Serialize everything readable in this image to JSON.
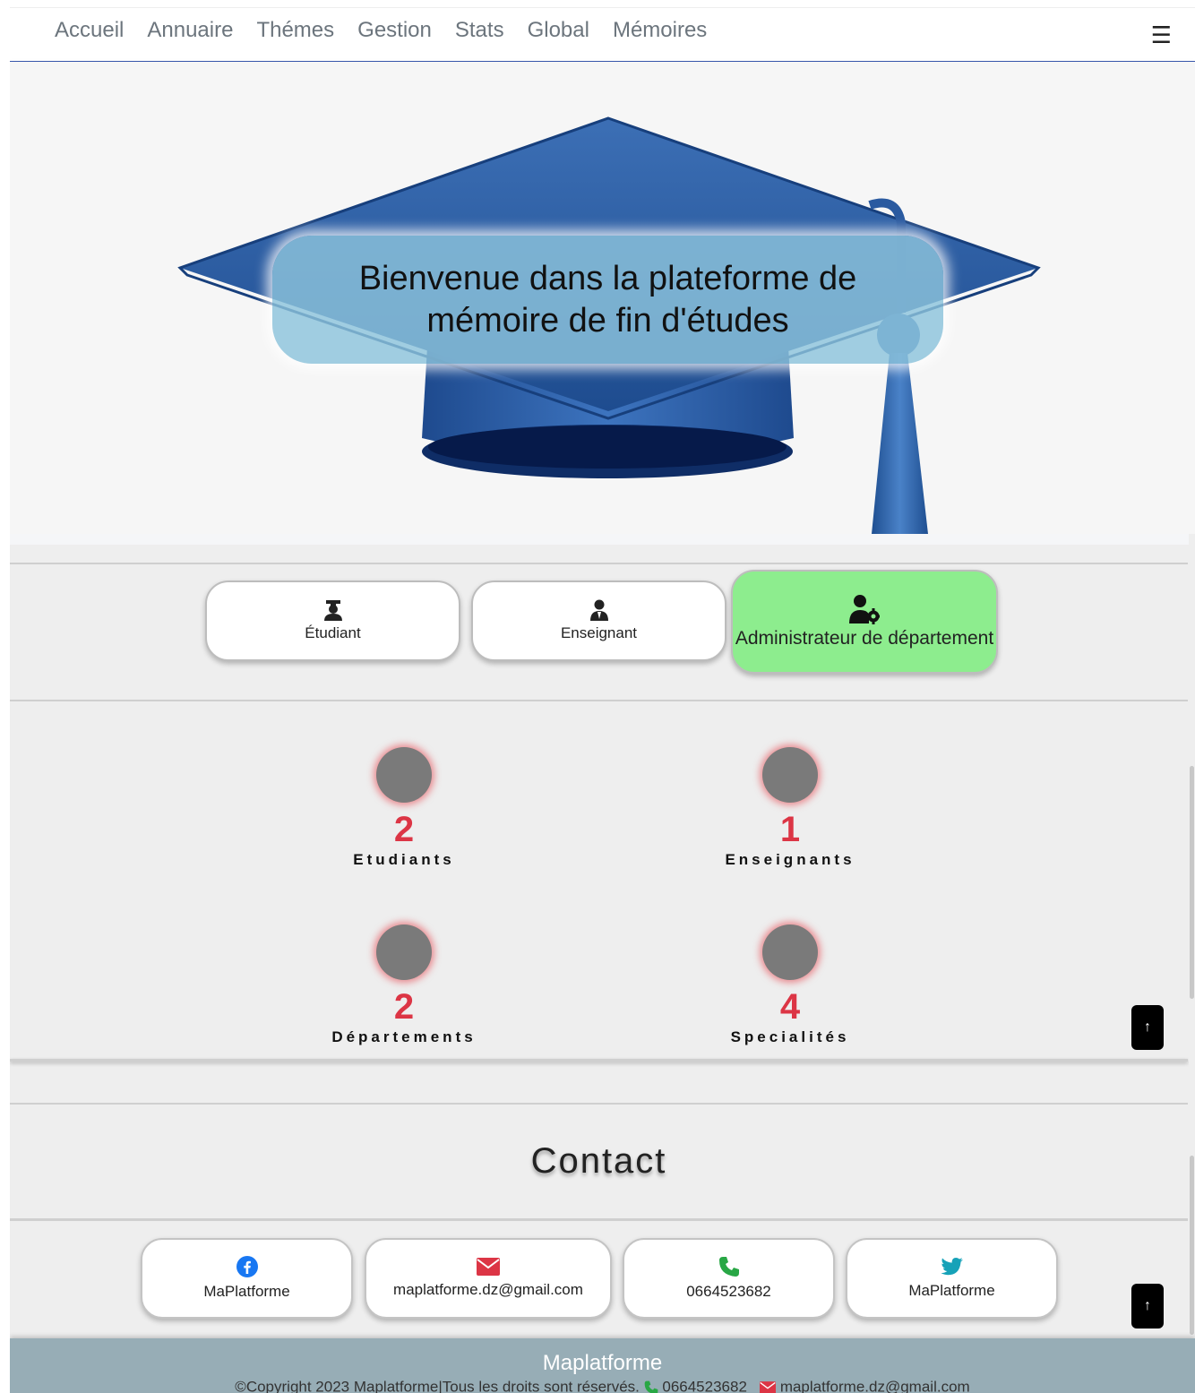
{
  "nav": {
    "links": [
      "Accueil",
      "Annuaire",
      "Thémes",
      "Gestion",
      "Stats",
      "Global",
      "Mémoires"
    ],
    "menu_icon": "hamburger-icon"
  },
  "hero": {
    "welcome": "Bienvenue dans la plateforme de mémoire de fin d'études",
    "cap_color": "#2a5aa0"
  },
  "roles": [
    {
      "label": "Étudiant",
      "icon": "graduate-icon",
      "active": false
    },
    {
      "label": "Enseignant",
      "icon": "teacher-icon",
      "active": false
    },
    {
      "label": "Administrateur de département",
      "icon": "user-gear-icon",
      "active": true
    }
  ],
  "stats": [
    {
      "value": "2",
      "label": "Etudiants"
    },
    {
      "value": "1",
      "label": "Enseignants"
    },
    {
      "value": "2",
      "label": "Départements"
    },
    {
      "value": "4",
      "label": "Specialités"
    }
  ],
  "contact": {
    "title": "Contact",
    "cards": [
      {
        "label": "MaPlatforme",
        "icon": "facebook-icon",
        "color": "#1877f2"
      },
      {
        "label": "maplatforme.dz@gmail.com",
        "icon": "envelope-icon",
        "color": "#dc3545"
      },
      {
        "label": "0664523682",
        "icon": "phone-icon",
        "color": "#28a745"
      },
      {
        "label": "MaPlatforme",
        "icon": "twitter-icon",
        "color": "#17a2b8"
      }
    ]
  },
  "footer": {
    "title": "Maplatforme",
    "copyright": "©Copyright 2023 Maplatforme|Tous les droits sont réservés.",
    "phone": "0664523682",
    "email": "maplatforme.dz@gmail.com"
  },
  "colors": {
    "accent_red": "#dc3545",
    "active_role": "#8ded8e",
    "footer_bg": "#97adb6"
  }
}
